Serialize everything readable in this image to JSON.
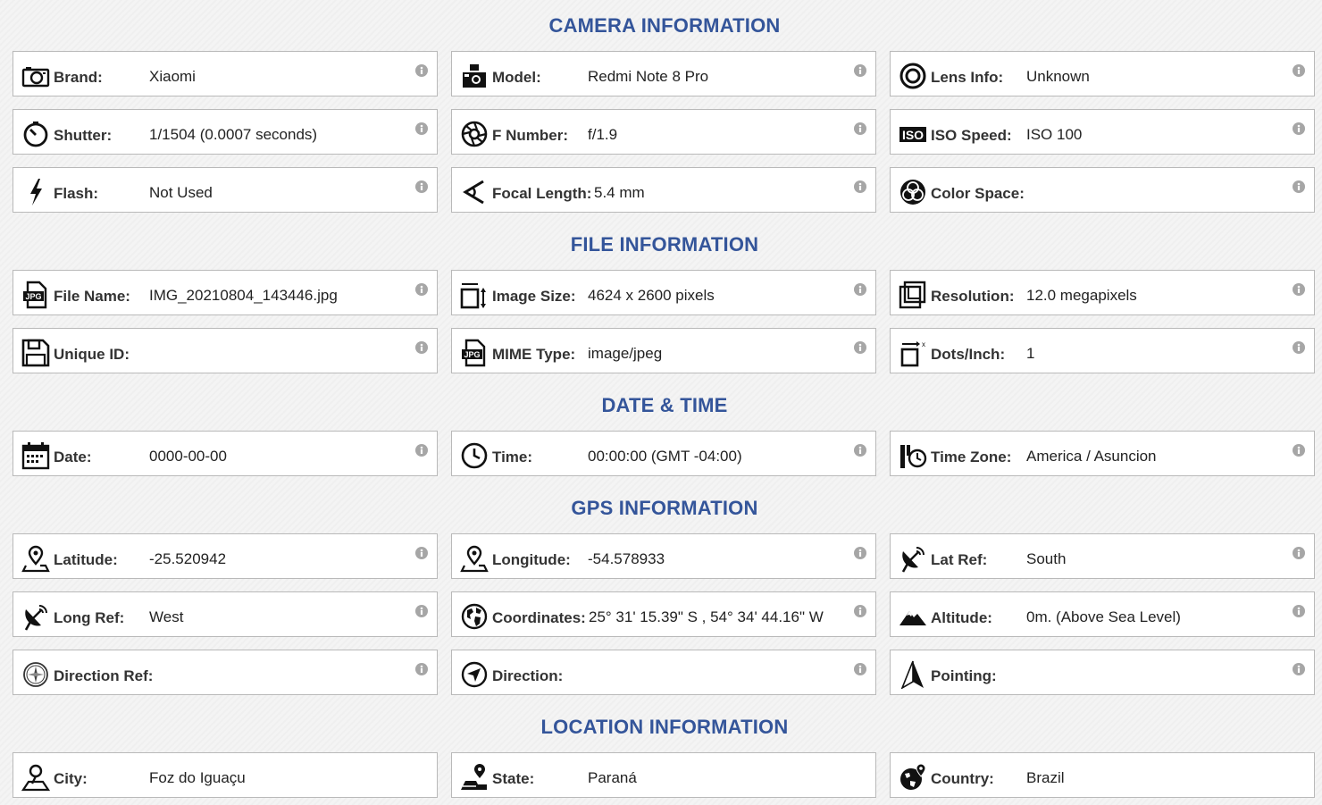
{
  "sections": [
    {
      "title": "CAMERA INFORMATION"
    },
    {
      "title": "FILE INFORMATION"
    },
    {
      "title": "DATE & TIME"
    },
    {
      "title": "GPS INFORMATION"
    },
    {
      "title": "LOCATION INFORMATION"
    }
  ],
  "fields": {
    "brand": {
      "label": "Brand:",
      "value": "Xiaomi",
      "icon": "camera-icon"
    },
    "model": {
      "label": "Model:",
      "value": "Redmi Note 8 Pro",
      "icon": "camera-model-icon"
    },
    "lens": {
      "label": "Lens Info:",
      "value": "Unknown",
      "icon": "lens-icon"
    },
    "shutter": {
      "label": "Shutter:",
      "value": "1/1504 (0.0007 seconds)",
      "icon": "stopwatch-icon"
    },
    "fnumber": {
      "label": "F Number:",
      "value": "f/1.9",
      "icon": "aperture-icon"
    },
    "iso": {
      "label": "ISO Speed:",
      "value": "ISO 100",
      "icon": "iso-icon"
    },
    "flash": {
      "label": "Flash:",
      "value": "Not Used",
      "icon": "flash-icon"
    },
    "focal": {
      "label": "Focal Length:",
      "value": "5.4 mm",
      "icon": "focal-length-icon"
    },
    "colorspace": {
      "label": "Color Space:",
      "value": "",
      "icon": "color-space-icon"
    },
    "filename": {
      "label": "File Name:",
      "value": "IMG_20210804_143446.jpg",
      "icon": "jpg-file-icon"
    },
    "imagesize": {
      "label": "Image Size:",
      "value": "4624 x 2600 pixels",
      "icon": "image-size-icon"
    },
    "resolution": {
      "label": "Resolution:",
      "value": "12.0 megapixels",
      "icon": "resolution-icon"
    },
    "uniqueid": {
      "label": "Unique ID:",
      "value": "",
      "icon": "save-disk-icon"
    },
    "mime": {
      "label": "MIME Type:",
      "value": "image/jpeg",
      "icon": "jpg-file-icon"
    },
    "dpi": {
      "label": "Dots/Inch:",
      "value": "1",
      "icon": "dpi-icon"
    },
    "date": {
      "label": "Date:",
      "value": "0000-00-00",
      "icon": "calendar-icon"
    },
    "time": {
      "label": "Time:",
      "value": "00:00:00 (GMT -04:00)",
      "icon": "clock-icon"
    },
    "timezone": {
      "label": "Time Zone:",
      "value": "America / Asuncion",
      "icon": "timezone-icon"
    },
    "latitude": {
      "label": "Latitude:",
      "value": "-25.520942",
      "icon": "map-pin-icon"
    },
    "longitude": {
      "label": "Longitude:",
      "value": "-54.578933",
      "icon": "map-pin-icon"
    },
    "latref": {
      "label": "Lat Ref:",
      "value": "South",
      "icon": "satellite-dish-icon"
    },
    "longref": {
      "label": "Long Ref:",
      "value": "West",
      "icon": "satellite-dish-icon"
    },
    "coordinates": {
      "label": "Coordinates:",
      "value": "25° 31' 15.39\" S , 54° 34' 44.16\" W",
      "icon": "globe-icon"
    },
    "altitude": {
      "label": "Altitude:",
      "value": "0m. (Above Sea Level)",
      "icon": "mountain-icon"
    },
    "directionref": {
      "label": "Direction Ref:",
      "value": "",
      "icon": "compass-icon"
    },
    "direction": {
      "label": "Direction:",
      "value": "",
      "icon": "direction-icon"
    },
    "pointing": {
      "label": "Pointing:",
      "value": "",
      "icon": "pointer-arrow-icon"
    },
    "city": {
      "label": "City:",
      "value": "Foz do Iguaçu",
      "icon": "person-pin-icon"
    },
    "state": {
      "label": "State:",
      "value": "Paraná",
      "icon": "state-pin-icon"
    },
    "country": {
      "label": "Country:",
      "value": "Brazil",
      "icon": "globe-pin-icon"
    }
  },
  "colors": {
    "heading": "#34559a",
    "info": "#a6a6a6"
  }
}
